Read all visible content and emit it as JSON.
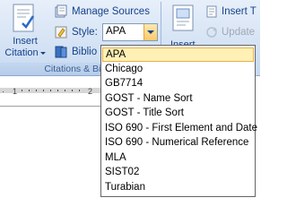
{
  "ribbon": {
    "insert_citation_label_1": "Insert",
    "insert_citation_label_2": "Citation",
    "manage_sources_label": "Manage Sources",
    "style_label": "Style:",
    "style_value": "APA",
    "bibliography_label": "Biblio",
    "group_label": "Citations & Biblio",
    "insert_table_figures_label": "Insert T",
    "update_table_label": "Update",
    "insert_caption_label": "Insert"
  },
  "dropdown": {
    "items": [
      "APA",
      "Chicago",
      "GB7714",
      "GOST - Name Sort",
      "GOST - Title Sort",
      "ISO 690 - First Element and Date",
      "ISO 690 - Numerical Reference",
      "MLA",
      "SIST02",
      "Turabian"
    ],
    "selected_index": 0
  }
}
